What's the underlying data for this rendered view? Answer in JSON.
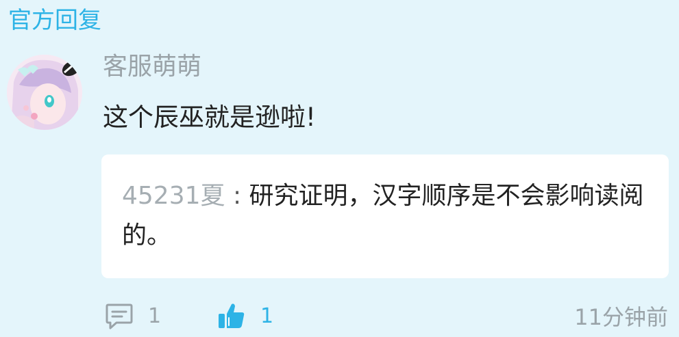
{
  "section": {
    "title": "官方回复"
  },
  "reply": {
    "username": "客服萌萌",
    "text": "这个辰巫就是逊啦!"
  },
  "quote": {
    "author": "45231夏",
    "separator": " : ",
    "text": "研究证明，汉字顺序是不会影响读阅的。"
  },
  "footer": {
    "comment_icon": "comment-icon",
    "comment_count": "1",
    "like_icon": "thumbs-up-icon",
    "like_count": "1",
    "timestamp": "11分钟前"
  },
  "colors": {
    "accent": "#2db3e6",
    "background": "#e4f5fb",
    "muted": "#9aa3a8"
  }
}
